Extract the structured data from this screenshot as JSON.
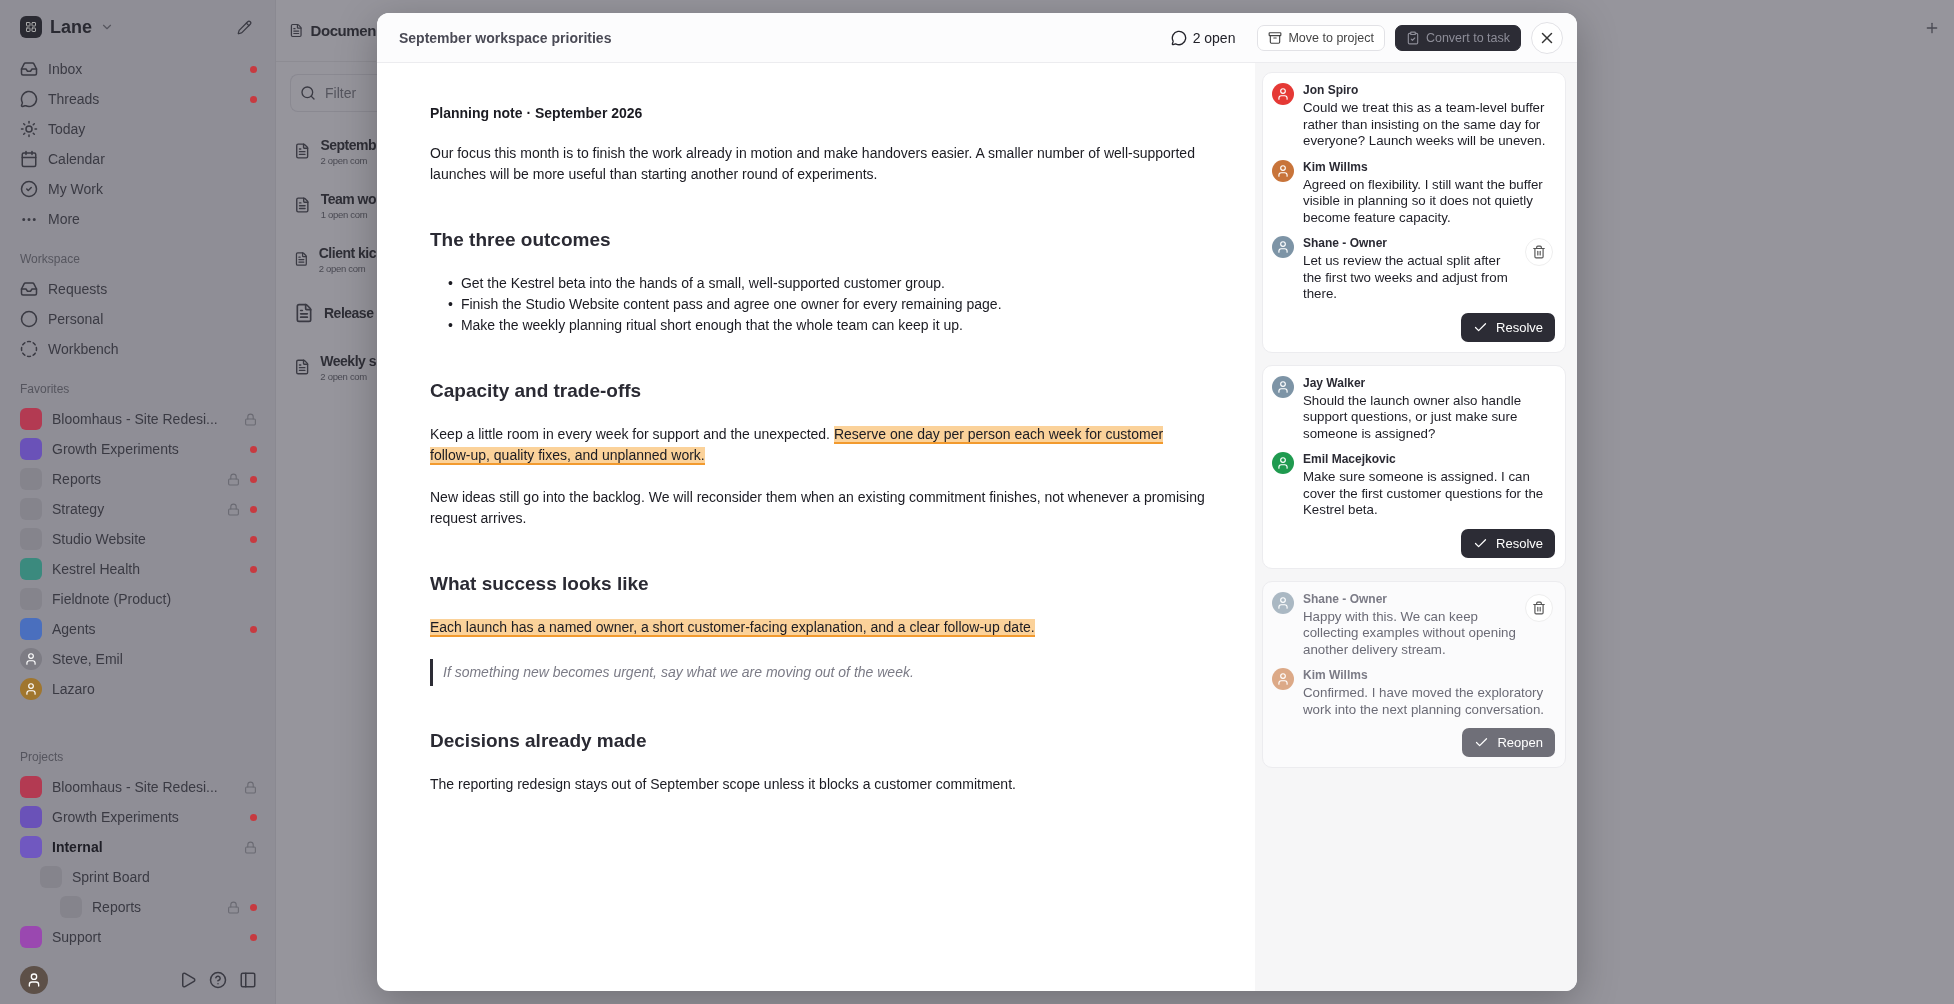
{
  "sidebar": {
    "workspace": "Lane",
    "nav": [
      {
        "label": "Inbox",
        "unread": true
      },
      {
        "label": "Threads",
        "unread": true
      },
      {
        "label": "Today",
        "unread": false
      },
      {
        "label": "Calendar",
        "unread": false
      },
      {
        "label": "My Work",
        "unread": false
      },
      {
        "label": "More",
        "unread": false
      }
    ],
    "workspace_section": {
      "title": "Workspace",
      "items": [
        {
          "label": "Requests"
        },
        {
          "label": "Personal"
        },
        {
          "label": "Workbench"
        }
      ]
    },
    "favorites": {
      "title": "Favorites",
      "items": [
        {
          "kind": "project",
          "label": "Bloomhaus - Site Redesi...",
          "color": "#b33a52",
          "locked": true,
          "unread": false
        },
        {
          "kind": "project",
          "label": "Growth Experiments",
          "color": "#6a52b8",
          "locked": false,
          "unread": true
        },
        {
          "kind": "project",
          "label": "Reports",
          "color": "#85848c",
          "locked": true,
          "unread": true
        },
        {
          "kind": "project",
          "label": "Strategy",
          "color": "#85848c",
          "locked": true,
          "unread": true
        },
        {
          "kind": "project",
          "label": "Studio Website",
          "color": "#85848c",
          "locked": false,
          "unread": true
        },
        {
          "kind": "project",
          "label": "Kestrel Health",
          "color": "#3b8a7e",
          "locked": false,
          "unread": true
        },
        {
          "kind": "project",
          "label": "Fieldnote (Product)",
          "color": "#85848c",
          "locked": false,
          "unread": false
        },
        {
          "kind": "project",
          "label": "Agents",
          "color": "#4a6fbe",
          "locked": false,
          "unread": true
        },
        {
          "kind": "people",
          "label": "Steve, Emil",
          "color": "#7d7c84",
          "locked": false,
          "unread": false
        },
        {
          "kind": "person",
          "label": "Lazaro",
          "color": "#a0762e",
          "locked": false,
          "unread": false
        }
      ]
    },
    "projects": {
      "title": "Projects",
      "items": [
        {
          "label": "Bloomhaus - Site Redesi...",
          "color": "#b33a52",
          "locked": true,
          "unread": false,
          "selected": false
        },
        {
          "label": "Growth Experiments",
          "color": "#6a52b8",
          "locked": false,
          "unread": true,
          "selected": false
        },
        {
          "label": "Internal",
          "color": "#7058c0",
          "locked": true,
          "unread": false,
          "selected": true,
          "children": [
            {
              "label": "Sprint Board",
              "color": "#85848c",
              "locked": false,
              "unread": false,
              "selected": false,
              "children": [
                {
                  "label": "Reports",
                  "color": "#85848c",
                  "locked": true,
                  "unread": true,
                  "selected": false
                }
              ]
            }
          ]
        },
        {
          "label": "Support",
          "color": "#9a48b0",
          "locked": false,
          "unread": true,
          "selected": false
        }
      ]
    }
  },
  "documents": {
    "title": "Documen",
    "filter": {
      "placeholder": "Filter"
    },
    "items": [
      {
        "title": "Septemb",
        "subtitle": "2 open com"
      },
      {
        "title": "Team wo",
        "subtitle": "1 open com"
      },
      {
        "title": "Client kic",
        "subtitle": "2 open com"
      },
      {
        "title": "Release"
      },
      {
        "title": "Weekly s",
        "subtitle": "2 open com"
      }
    ]
  },
  "modal": {
    "title": "September workspace priorities",
    "open_count": "2 open",
    "buttons": [
      {
        "label": "Move to project",
        "disabled": false
      },
      {
        "label": "Convert to task",
        "disabled": true
      }
    ],
    "blocks": [
      {
        "kind": "label",
        "text": "Planning note · September 2026"
      },
      {
        "kind": "paragraph",
        "segments": [
          {
            "text": "Our focus this month is to finish the work already in motion and make handovers easier. A smaller number of well-supported launches will be more useful than starting another round of experiments.",
            "highlighted": false
          }
        ]
      },
      {
        "kind": "heading",
        "text": "The three outcomes"
      },
      {
        "kind": "list",
        "marker": "•",
        "items": [
          "Get the Kestrel beta into the hands of a small, well-supported customer group.",
          "Finish the Studio Website content pass and agree one owner for every remaining page.",
          "Make the weekly planning ritual short enough that the whole team can keep it up."
        ]
      },
      {
        "kind": "heading",
        "text": "Capacity and trade-offs"
      },
      {
        "kind": "paragraph",
        "segments": [
          {
            "text": "Keep a little room in every week for support and the unexpected. ",
            "highlighted": false
          },
          {
            "text": "Reserve one day per person each week for customer follow-up, quality fixes, and unplanned work.",
            "highlighted": true
          }
        ]
      },
      {
        "kind": "paragraph",
        "segments": [
          {
            "text": "New ideas still go into the backlog. We will reconsider them when an existing commitment finishes, not whenever a promising request arrives.",
            "highlighted": false
          }
        ]
      },
      {
        "kind": "heading",
        "text": "What success looks like"
      },
      {
        "kind": "paragraph",
        "segments": [
          {
            "text": "Each launch has a named owner, a short customer-facing explanation, and a clear follow-up date.",
            "highlighted": true
          }
        ]
      },
      {
        "kind": "quote",
        "text": "If something new becomes urgent, say what we are moving out of the week."
      },
      {
        "kind": "heading",
        "text": "Decisions already made"
      },
      {
        "kind": "paragraph",
        "segments": [
          {
            "text": "The reporting redesign stays out of September scope unless it blocks a customer commitment.",
            "highlighted": false
          }
        ]
      }
    ],
    "threads": [
      {
        "resolved": false,
        "action": "Resolve",
        "comments": [
          {
            "author": "Jon Spiro",
            "color": "#e53935",
            "body": "Could we treat this as a team-level buffer rather than insisting on the same day for everyone? Launch weeks will be uneven.",
            "deletable": false
          },
          {
            "author": "Kim Willms",
            "color": "#c8743a",
            "body": "Agreed on flexibility. I still want the buffer visible in planning so it does not quietly become feature capacity.",
            "deletable": false
          },
          {
            "author": "Shane - Owner",
            "color": "#7d94a6",
            "body": "Let us review the actual split after the first two weeks and adjust from there.",
            "deletable": true
          }
        ]
      },
      {
        "resolved": false,
        "action": "Resolve",
        "comments": [
          {
            "author": "Jay Walker",
            "color": "#7d94a6",
            "body": "Should the launch owner also handle support questions, or just make sure someone is assigned?",
            "deletable": false
          },
          {
            "author": "Emil Macejkovic",
            "color": "#1f9a4f",
            "body": "Make sure someone is assigned. I can cover the first customer questions for the Kestrel beta.",
            "deletable": false
          }
        ]
      },
      {
        "resolved": true,
        "action": "Reopen",
        "comments": [
          {
            "author": "Shane - Owner",
            "color": "#aab8c3",
            "body": "Happy with this. We can keep collecting examples without opening another delivery stream.",
            "deletable": true
          },
          {
            "author": "Kim Willms",
            "color": "#dca987",
            "body": "Confirmed. I have moved the exploratory work into the next planning conversation.",
            "deletable": false
          }
        ]
      }
    ]
  }
}
